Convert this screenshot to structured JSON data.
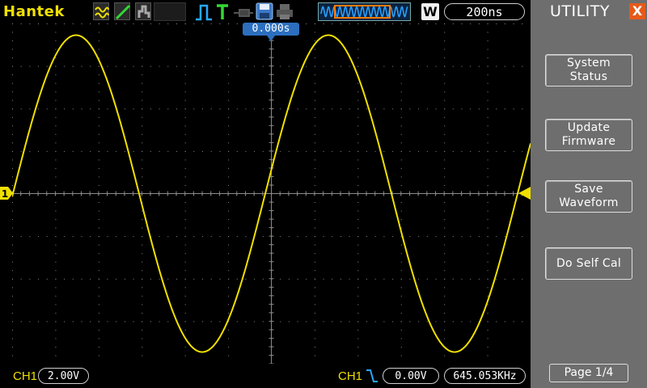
{
  "app": {
    "brand": "Hantek"
  },
  "toolbar": {
    "icons": [
      "waveform-display-icon",
      "vector-mode-icon",
      "persistence-icon",
      "trigger-type-icon",
      "trigger-status-icon",
      "probe-icon",
      "save-icon",
      "print-icon"
    ]
  },
  "timebase": {
    "mode_letter": "W",
    "value": "200ns",
    "trigger_position": "0.000s"
  },
  "channel": {
    "name": "CH1",
    "volts_per_div": "2.00V",
    "marker": "1",
    "color": "#f0e000"
  },
  "trigger": {
    "source": "CH1",
    "slope": "falling-edge-icon",
    "level": "0.00V",
    "frequency": "645.053KHz"
  },
  "side_menu": {
    "title": "UTILITY",
    "close_label": "X",
    "buttons": [
      "System\nStatus",
      "Update\nFirmware",
      "Save\nWaveform",
      "Do Self Cal"
    ],
    "page": "Page 1/4"
  },
  "colors": {
    "trace": "#f0e000",
    "grid": "#8a8a8a",
    "accent_blue": "#2c6fbf",
    "close_red": "#e55a1b",
    "panel_gray": "#6e6e6e"
  }
}
